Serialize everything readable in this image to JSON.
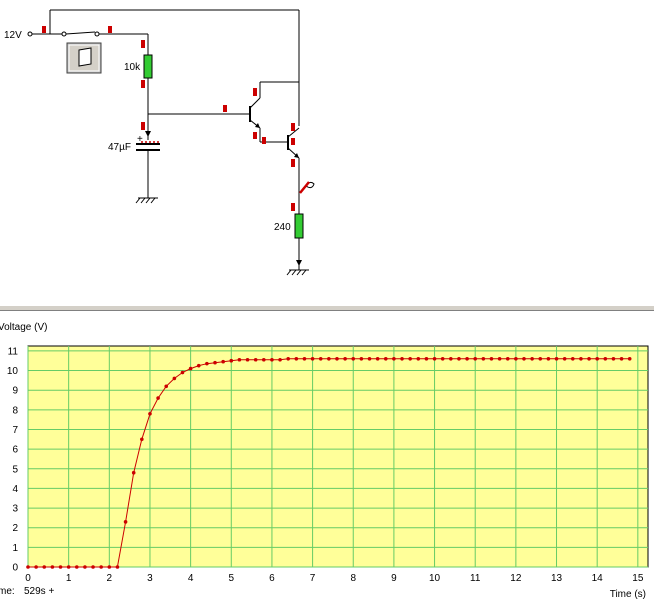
{
  "circuit": {
    "supply_label": "12V",
    "resistor1_label": "10k",
    "capacitor_label": "47µF",
    "resistor2_label": "240"
  },
  "chart_data": {
    "type": "line",
    "ylabel": "Voltage (V)",
    "xlabel": "Time (s)",
    "xlim": [
      0,
      15.25
    ],
    "ylim": [
      0,
      11.25
    ],
    "x_ticks": [
      0,
      1,
      2,
      3,
      4,
      5,
      6,
      7,
      8,
      9,
      10,
      11,
      12,
      13,
      14,
      15
    ],
    "y_ticks": [
      0,
      1,
      2,
      3,
      4,
      5,
      6,
      7,
      8,
      9,
      10,
      11
    ],
    "grid": true,
    "background_color": "#ffff99",
    "grid_color": "#66cc66",
    "line_color": "#cc0000",
    "time_readout": "529s +",
    "time_readout_prefix": "me:",
    "series": [
      {
        "x": [
          0,
          0.2,
          0.4,
          0.6,
          0.8,
          1.0,
          1.2,
          1.4,
          1.6,
          1.8,
          2.0,
          2.2,
          2.4,
          2.6,
          2.8,
          3.0,
          3.2,
          3.4,
          3.6,
          3.8,
          4.0,
          4.2,
          4.4,
          4.6,
          4.8,
          5.0,
          5.2,
          5.4,
          5.6,
          5.8,
          6.0,
          6.2,
          6.4,
          6.6,
          6.8,
          7.0,
          7.2,
          7.4,
          7.6,
          7.8,
          8.0,
          8.2,
          8.4,
          8.6,
          8.8,
          9.0,
          9.2,
          9.4,
          9.6,
          9.8,
          10.0,
          10.2,
          10.4,
          10.6,
          10.8,
          11.0,
          11.2,
          11.4,
          11.6,
          11.8,
          12.0,
          12.2,
          12.4,
          12.6,
          12.8,
          13.0,
          13.2,
          13.4,
          13.6,
          13.8,
          14.0,
          14.2,
          14.4,
          14.6,
          14.8
        ],
        "y": [
          0,
          0,
          0,
          0,
          0,
          0,
          0,
          0,
          0,
          0,
          0,
          0,
          2.3,
          4.8,
          6.5,
          7.8,
          8.6,
          9.2,
          9.6,
          9.9,
          10.1,
          10.25,
          10.35,
          10.4,
          10.45,
          10.5,
          10.55,
          10.55,
          10.55,
          10.55,
          10.55,
          10.55,
          10.6,
          10.6,
          10.6,
          10.6,
          10.6,
          10.6,
          10.6,
          10.6,
          10.6,
          10.6,
          10.6,
          10.6,
          10.6,
          10.6,
          10.6,
          10.6,
          10.6,
          10.6,
          10.6,
          10.6,
          10.6,
          10.6,
          10.6,
          10.6,
          10.6,
          10.6,
          10.6,
          10.6,
          10.6,
          10.6,
          10.6,
          10.6,
          10.6,
          10.6,
          10.6,
          10.6,
          10.6,
          10.6,
          10.6,
          10.6,
          10.6,
          10.6,
          10.6
        ]
      }
    ]
  }
}
